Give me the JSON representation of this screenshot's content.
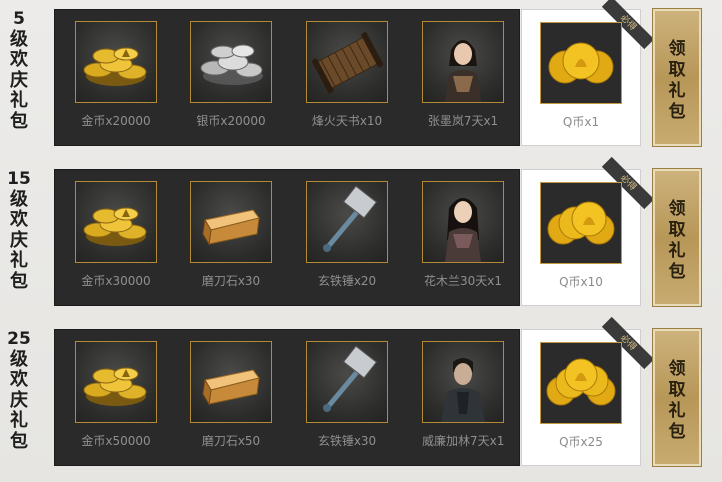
{
  "tiers": [
    {
      "level": "5",
      "label_chars": [
        "级",
        "欢",
        "庆",
        "礼",
        "包"
      ],
      "items": [
        {
          "label": "金币x20000",
          "icon": "gold-coins-icon"
        },
        {
          "label": "银币x20000",
          "icon": "silver-coins-icon"
        },
        {
          "label": "烽火天书x10",
          "icon": "scroll-icon"
        },
        {
          "label": "张墨岚7天x1",
          "icon": "character-portrait-icon"
        }
      ],
      "special": {
        "label": "Q币x1",
        "ribbon": "必得",
        "icon": "q-coins-icon"
      },
      "claim": [
        "领",
        "取",
        "礼",
        "包"
      ]
    },
    {
      "level": "15",
      "label_chars": [
        "级",
        "欢",
        "庆",
        "礼",
        "包"
      ],
      "items": [
        {
          "label": "金币x30000",
          "icon": "gold-coins-icon"
        },
        {
          "label": "磨刀石x30",
          "icon": "whetstone-icon"
        },
        {
          "label": "玄铁锤x20",
          "icon": "hammer-icon"
        },
        {
          "label": "花木兰30天x1",
          "icon": "character-portrait-icon"
        }
      ],
      "special": {
        "label": "Q币x10",
        "ribbon": "必得",
        "icon": "q-coins-icon"
      },
      "claim": [
        "领",
        "取",
        "礼",
        "包"
      ]
    },
    {
      "level": "25",
      "label_chars": [
        "级",
        "欢",
        "庆",
        "礼",
        "包"
      ],
      "items": [
        {
          "label": "金币x50000",
          "icon": "gold-coins-icon"
        },
        {
          "label": "磨刀石x50",
          "icon": "whetstone-icon"
        },
        {
          "label": "玄铁锤x30",
          "icon": "hammer-icon"
        },
        {
          "label": "威廉加林7天x1",
          "icon": "character-portrait-icon"
        }
      ],
      "special": {
        "label": "Q币x25",
        "ribbon": "必得",
        "icon": "q-coins-icon"
      },
      "claim": [
        "领",
        "取",
        "礼",
        "包"
      ]
    }
  ],
  "colors": {
    "panel": "#2a2a2a",
    "frame_gold": "#b48a34",
    "claim_gold": "#bfa064",
    "label_gray": "#8f8f8f"
  }
}
